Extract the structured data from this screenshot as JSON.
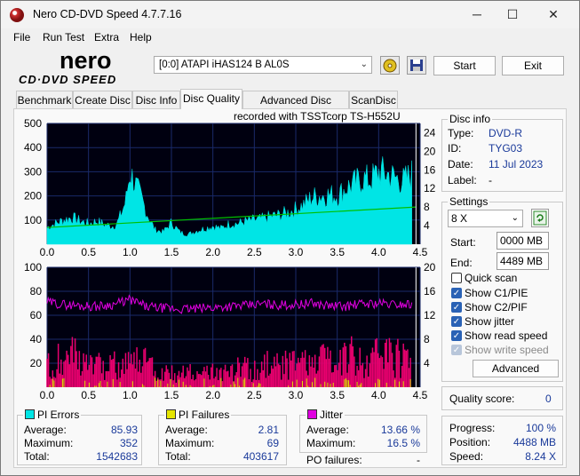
{
  "window": {
    "title": "Nero CD-DVD Speed 4.7.7.16",
    "minimize": "─",
    "maximize": "☐",
    "close": "✕"
  },
  "menu": [
    "File",
    "Run Test",
    "Extra",
    "Help"
  ],
  "logo": {
    "line1": "nero",
    "line2": "CD·DVD SPEED"
  },
  "drive": {
    "selected": "[0:0]   ATAPI iHAS124   B AL0S"
  },
  "toolbar": {
    "start": "Start",
    "exit": "Exit"
  },
  "tabs": [
    "Benchmark",
    "Create Disc",
    "Disc Info",
    "Disc Quality",
    "Advanced Disc Quality",
    "ScanDisc"
  ],
  "recorded_with": "recorded with TSSTcorp  TS-H552U",
  "disc_info": {
    "title": "Disc info",
    "type_label": "Type:",
    "type": "DVD-R",
    "id_label": "ID:",
    "id": "TYG03",
    "date_label": "Date:",
    "date": "11 Jul 2023",
    "label_label": "Label:",
    "label": "-"
  },
  "settings": {
    "title": "Settings",
    "speed": "8 X",
    "start_label": "Start:",
    "start": "0000 MB",
    "end_label": "End:",
    "end": "4489 MB",
    "quick_scan": "Quick scan",
    "show_c1": "Show C1/PIE",
    "show_c2": "Show C2/PIF",
    "show_jitter": "Show jitter",
    "show_read": "Show read speed",
    "show_write": "Show write speed",
    "advanced": "Advanced"
  },
  "quality": {
    "label": "Quality score:",
    "value": "0"
  },
  "progress": {
    "progress_label": "Progress:",
    "progress": "100 %",
    "position_label": "Position:",
    "position": "4488 MB",
    "speed_label": "Speed:",
    "speed": "8.24 X"
  },
  "pi_errors": {
    "title": "PI Errors",
    "avg_label": "Average:",
    "avg": "85.93",
    "max_label": "Maximum:",
    "max": "352",
    "total_label": "Total:",
    "total": "1542683"
  },
  "pi_failures": {
    "title": "PI Failures",
    "avg_label": "Average:",
    "avg": "2.81",
    "max_label": "Maximum:",
    "max": "69",
    "total_label": "Total:",
    "total": "403617"
  },
  "jitter": {
    "title": "Jitter",
    "avg_label": "Average:",
    "avg": "13.66 %",
    "max_label": "Maximum:",
    "max": "16.5 %"
  },
  "po_failures": {
    "label": "PO failures:",
    "value": "-"
  },
  "colors": {
    "pie": "#00e5e5",
    "pif": "#e5e500",
    "jitter": "#e000e0",
    "chart_bg": "#000010",
    "grid": "#1a2a6a",
    "read_speed": "#00c000",
    "pif_bars": "#e8006e"
  },
  "chart_data": [
    {
      "type": "area",
      "x_ticks": [
        "0.0",
        "0.5",
        "1.0",
        "1.5",
        "2.0",
        "2.5",
        "3.0",
        "3.5",
        "4.0",
        "4.5"
      ],
      "y_left_ticks": [
        "100",
        "200",
        "300",
        "400",
        "500"
      ],
      "y_right_ticks": [
        "4",
        "8",
        "12",
        "16",
        "20",
        "24"
      ],
      "xlim": [
        0,
        4.5
      ],
      "ylim": [
        0,
        500
      ],
      "y2lim": [
        0,
        26
      ],
      "series": [
        {
          "name": "PI Errors",
          "x": [
            0.0,
            0.1,
            0.2,
            0.3,
            0.4,
            0.5,
            0.6,
            0.7,
            0.8,
            0.85,
            0.9,
            0.95,
            1.0,
            1.05,
            1.1,
            1.15,
            1.2,
            1.3,
            1.4,
            1.5,
            1.6,
            1.7,
            1.8,
            1.9,
            2.0,
            2.1,
            2.2,
            2.3,
            2.4,
            2.5,
            2.6,
            2.7,
            2.8,
            2.9,
            3.0,
            3.1,
            3.2,
            3.3,
            3.4,
            3.5,
            3.6,
            3.7,
            3.8,
            3.9,
            4.0,
            4.1,
            4.2,
            4.3,
            4.4
          ],
          "values": [
            70,
            85,
            100,
            110,
            95,
            85,
            95,
            80,
            75,
            90,
            130,
            180,
            300,
            260,
            220,
            180,
            130,
            60,
            50,
            90,
            50,
            40,
            55,
            65,
            75,
            65,
            85,
            85,
            95,
            100,
            105,
            115,
            120,
            130,
            145,
            165,
            195,
            200,
            205,
            200,
            230,
            250,
            270,
            265,
            300,
            290,
            275,
            260,
            290
          ]
        },
        {
          "name": "Read Speed",
          "x": [
            0.0,
            4.45
          ],
          "values": [
            3.6,
            8.0
          ]
        }
      ]
    },
    {
      "type": "bar",
      "x_ticks": [
        "0.0",
        "0.5",
        "1.0",
        "1.5",
        "2.0",
        "2.5",
        "3.0",
        "3.5",
        "4.0",
        "4.5"
      ],
      "y_left_ticks": [
        "20",
        "40",
        "60",
        "80",
        "100"
      ],
      "y_right_ticks": [
        "4",
        "8",
        "12",
        "16",
        "20"
      ],
      "xlim": [
        0,
        4.5
      ],
      "ylim": [
        0,
        100
      ],
      "y2lim": [
        0,
        20
      ],
      "series": [
        {
          "name": "PI Failures",
          "x": [
            0.0,
            0.1,
            0.2,
            0.3,
            0.4,
            0.5,
            0.6,
            0.7,
            0.8,
            0.9,
            1.0,
            1.05,
            1.1,
            1.2,
            1.3,
            1.4,
            1.5,
            1.6,
            1.7,
            1.8,
            1.9,
            2.0,
            2.1,
            2.2,
            2.3,
            2.4,
            2.5,
            2.6,
            2.7,
            2.8,
            2.9,
            3.0,
            3.1,
            3.2,
            3.3,
            3.4,
            3.5,
            3.6,
            3.7,
            3.8,
            3.9,
            4.0,
            4.1,
            4.2,
            4.3,
            4.4
          ],
          "values": [
            18,
            20,
            25,
            28,
            22,
            18,
            20,
            15,
            18,
            20,
            35,
            50,
            30,
            18,
            14,
            12,
            12,
            10,
            12,
            10,
            10,
            12,
            12,
            14,
            16,
            15,
            14,
            16,
            20,
            18,
            18,
            20,
            20,
            22,
            22,
            20,
            22,
            24,
            26,
            25,
            24,
            26,
            28,
            26,
            24,
            22
          ]
        },
        {
          "name": "Jitter",
          "x": [
            0.0,
            0.2,
            0.4,
            0.6,
            0.8,
            1.0,
            1.2,
            1.4,
            1.6,
            1.8,
            2.0,
            2.2,
            2.4,
            2.6,
            2.8,
            3.0,
            3.2,
            3.4,
            3.6,
            3.8,
            4.0,
            4.2,
            4.4
          ],
          "values": [
            14.2,
            13.8,
            13.6,
            13.5,
            13.8,
            14.6,
            13.4,
            13.2,
            13.0,
            13.1,
            13.3,
            13.5,
            13.6,
            13.9,
            13.7,
            13.8,
            14.0,
            13.6,
            13.5,
            13.9,
            14.0,
            13.8,
            13.9
          ]
        }
      ]
    }
  ]
}
